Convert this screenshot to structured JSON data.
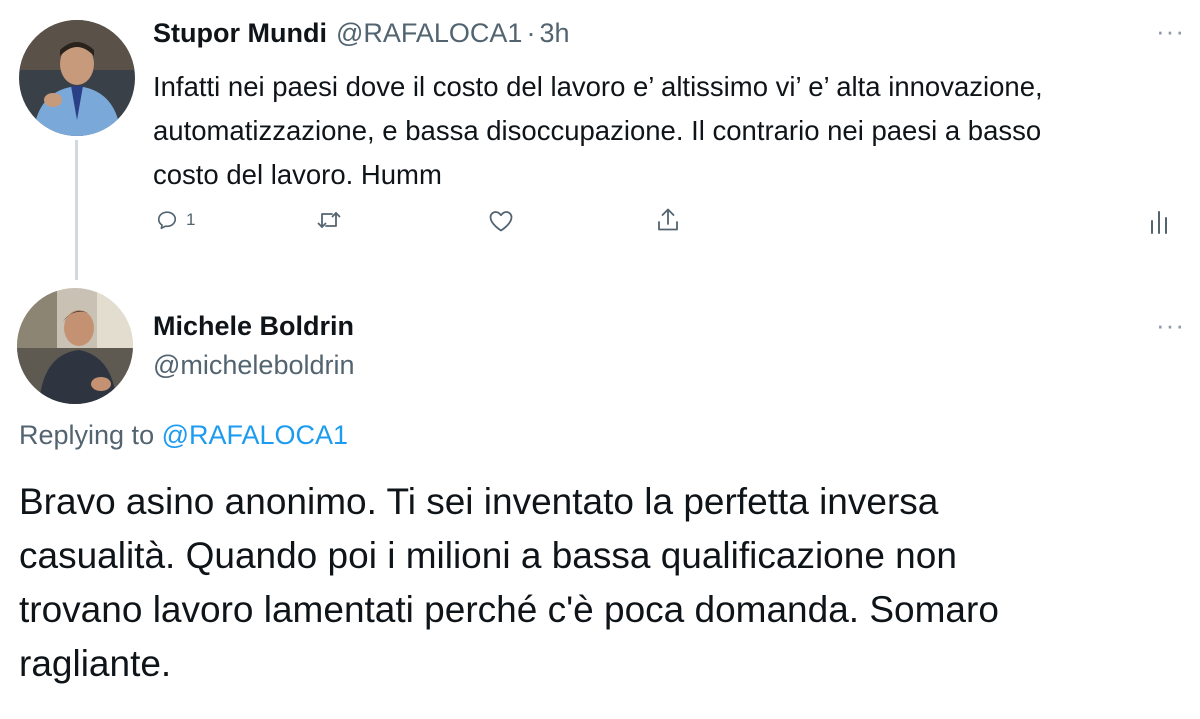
{
  "tweet1": {
    "name": "Stupor Mundi",
    "handle": "@RAFALOCA1",
    "separator": "·",
    "time": "3h",
    "more": "···",
    "text_lines": [
      "Infatti nei paesi dove il costo del lavoro e’ altissimo vi’ e’ alta innovazione,",
      "automatizzazione, e bassa disoccupazione.  Il contrario nei paesi a basso",
      "costo del lavoro.  Humm"
    ],
    "actions": {
      "reply_count": "1",
      "reply_icon": "reply-icon",
      "retweet_icon": "retweet-icon",
      "like_icon": "like-icon",
      "share_icon": "share-icon",
      "analytics_icon": "analytics-icon"
    }
  },
  "tweet2": {
    "name": "Michele Boldrin",
    "handle": "@micheleboldrin",
    "more": "···",
    "replying_prefix": "Replying to ",
    "replying_to": "@RAFALOCA1",
    "text_lines": [
      "Bravo asino anonimo. Ti sei inventato la perfetta inversa",
      "casualità. Quando poi i milioni a bassa qualificazione non",
      "trovano lavoro lamentati perché c'è poca domanda. Somaro",
      "ragliante."
    ]
  },
  "colors": {
    "text": "#0f1419",
    "secondary": "#536471",
    "link": "#1d9bf0",
    "thread_line": "#cfd9de"
  }
}
